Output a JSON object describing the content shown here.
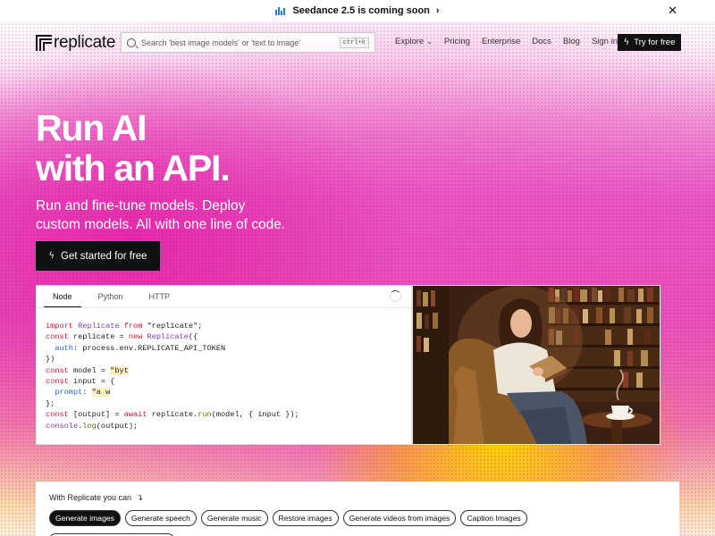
{
  "announcement": {
    "text": "Seedance 2.5 is coming soon",
    "arrow": "›",
    "close": "✕",
    "icon": "bar-chart-icon",
    "icon_color": "#2b7bdc"
  },
  "nav": {
    "logo_text": "replicate",
    "search_placeholder": "Search 'best image models' or 'text to image'",
    "search_shortcut": "ctrl+k",
    "links": [
      {
        "label": "Explore",
        "has_caret": true
      },
      {
        "label": "Pricing"
      },
      {
        "label": "Enterprise"
      },
      {
        "label": "Docs"
      },
      {
        "label": "Blog"
      },
      {
        "label": "Sign in"
      }
    ],
    "try_label": "Try for free"
  },
  "hero": {
    "title_line1": "Run AI",
    "title_line2": "with an API.",
    "subtitle_line1": "Run and fine-tune models. Deploy",
    "subtitle_line2": "custom models. All with one line of code.",
    "cta_label": "Get started for free"
  },
  "code_card": {
    "tabs": [
      "Node",
      "Python",
      "HTTP"
    ],
    "active_tab": "Node"
  },
  "with_replicate": {
    "label": "With Replicate you can",
    "pills": [
      "Generate images",
      "Generate speech",
      "Generate music",
      "Restore images",
      "Generate videos from images",
      "Caption Images"
    ],
    "active_pill": "Generate images"
  },
  "colors": {
    "accent_dark": "#111111",
    "hero_pink": "#e957c7",
    "hero_yellow": "#ffd700"
  }
}
